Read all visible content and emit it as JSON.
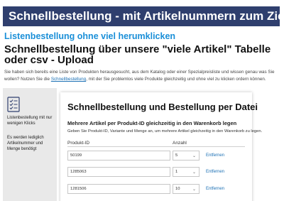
{
  "header": {
    "banner_title": "Schnellbestellung - mit Artikelnummern zum Ziel",
    "subheading": "Listenbestellung ohne viel herumklicken",
    "title": "Schnellbestellung über unsere \"viele Artikel\" Tabelle oder csv - Upload"
  },
  "intro": {
    "text_before": "Sie haben sich bereits eine Liste von Produkten herausgesucht, aus dem Katalog oder einer Spezialpreisliste und wissen genau was Sie wollen? Nutzen Sie die ",
    "link_text": "Schnellbestellung",
    "text_after": ", mit der Sie problemlos viele Produkte gleichzeitig und ohne viel zu klicken ordern können."
  },
  "sidebar": {
    "icon": "checklist-icon",
    "text1": "Listenbestellung mit nur wenigen Klicks",
    "text2": "Es werden lediglich Artikelnummer und Menge benötigt"
  },
  "card": {
    "title": "Schnellbestellung und Bestellung per Datei",
    "subtitle": "Mehrere Artikel per Produkt-ID gleichzeitig in den Warenkorb legen",
    "description": "Geben Sie Produkt-ID, Variante und Menge an, um mehrere Artikel gleichzeitig in den Warenkorb zu legen.",
    "col_product_id": "Produkt-ID",
    "col_quantity": "Anzahl",
    "rows": [
      {
        "product_id": "50199",
        "quantity": "5",
        "remove": "Entfernen"
      },
      {
        "product_id": "1285063",
        "quantity": "1",
        "remove": "Entfernen"
      },
      {
        "product_id": "1281506",
        "quantity": "10",
        "remove": "Entfernen"
      }
    ]
  }
}
